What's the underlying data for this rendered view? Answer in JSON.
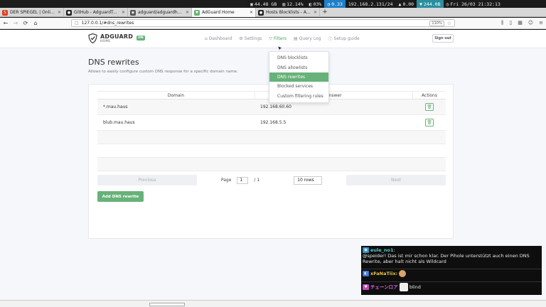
{
  "status": {
    "disk": "44.48 GB",
    "cpu": "12.14%",
    "mem": "03%",
    "load": "0.33",
    "net": "192.168.2.131/24",
    "up": "0.00",
    "down": "244.0B",
    "clock": "Fri 26/03 21:32:13"
  },
  "tabs": [
    {
      "title": "DER SPIEGEL | Online-Nachrichten",
      "icon": "spiegel-icon",
      "color": "#e0401e",
      "glyph": "S"
    },
    {
      "title": "GitHub - AdguardTeam/AdGuardHome",
      "icon": "github-icon",
      "color": "#222222",
      "glyph": "●"
    },
    {
      "title": "adguard/adguardhome - Docker Hub",
      "icon": "docker-icon",
      "color": "#555555",
      "glyph": "◉"
    },
    {
      "title": "AdGuard Home",
      "icon": "adguard-icon",
      "color": "#67b279",
      "glyph": "▼",
      "active": true
    },
    {
      "title": "Hosts Blocklists - Adguard",
      "icon": "github-icon",
      "color": "#222222",
      "glyph": "●"
    }
  ],
  "url": "127.0.0.1/#dns_rewrites",
  "zoom": "110%",
  "app": {
    "brand": "ADGUARD",
    "brand_sub": "HOME",
    "on_badge": "ON",
    "nav": [
      {
        "label": "Dashboard",
        "icon": "home-icon",
        "glyph": "⌂"
      },
      {
        "label": "Settings",
        "icon": "gear-icon",
        "glyph": "⚙"
      },
      {
        "label": "Filters",
        "icon": "filter-icon",
        "glyph": "⏷",
        "active": true
      },
      {
        "label": "Query Log",
        "icon": "document-icon",
        "glyph": "▤"
      },
      {
        "label": "Setup guide",
        "icon": "help-icon",
        "glyph": "ⓘ"
      }
    ],
    "signout": "Sign out"
  },
  "dropdown": [
    "DNS blocklists",
    "DNS allowlists",
    "DNS rewrites",
    "Blocked services",
    "Custom filtering rules"
  ],
  "dropdown_active": 2,
  "page": {
    "title": "DNS rewrites",
    "description": "Allows to easily configure custom DNS response for a specific domain name."
  },
  "table": {
    "headers": [
      "Domain",
      "Answer",
      "Actions"
    ],
    "rows": [
      {
        "domain": "*.mau.haus",
        "answer": "192.168.60.60"
      },
      {
        "domain": "blub.mau.haus",
        "answer": "192.168.5.5"
      }
    ]
  },
  "pager": {
    "previous": "Previous",
    "next": "Next",
    "page_label": "Page",
    "page": "1",
    "of": "/ 1",
    "rows": "10 rows"
  },
  "add_button": "Add DNS rewrite",
  "chat": [
    {
      "user": "eule_no1",
      "text": "@speider! Das ist mir schon klar. Der Pihole unterstützt auch einen DNS Rewrite, aber halt nicht als Wildcard"
    },
    {
      "user": "xFaNaTiix:",
      "text": ""
    },
    {
      "user": "チェーンロア",
      "text": "blind"
    }
  ]
}
